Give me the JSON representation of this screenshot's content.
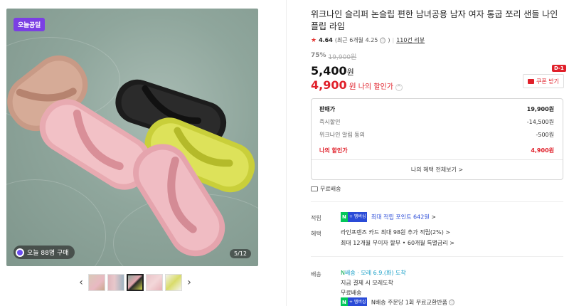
{
  "gallery": {
    "badge": "오늘공딜",
    "buy_count": "오늘 88명 구매",
    "counter": "5/12",
    "prev": "‹",
    "next": "›",
    "thumb_count": 5,
    "active_thumb": 3
  },
  "product": {
    "title": "위크나인 슬리퍼 논슬립 편한 남녀공용 남자 여자 통굽 쪼리 샌들 나인플립 라임",
    "rating_score": "4.64",
    "rating_note": "(최근 6개월 4.25",
    "rating_icon": "ⓘ",
    "rating_close": ")",
    "review_count": "110건 리뷰",
    "discount_pct": "75%",
    "original_price": "19,900원",
    "price": "5,400",
    "price_unit": "원",
    "my_price": "4,900",
    "my_price_unit": "원",
    "my_price_label": "나의 할인가",
    "my_price_chevron": "^"
  },
  "coupon": {
    "label": "쿠폰 받기",
    "dday": "D-1"
  },
  "discount_box": {
    "rows": [
      {
        "label": "판매가",
        "value": "19,900원"
      },
      {
        "label": "즉시할인",
        "value": "-14,500원"
      },
      {
        "label": "위크나인 알림 동의",
        "value": "-500원"
      }
    ],
    "mine": {
      "label": "나의 할인가",
      "value": "4,900원"
    },
    "more": "나의 혜택 전체보기 >"
  },
  "shipping": {
    "label": "무료배송"
  },
  "benefits": {
    "points_label": "적립",
    "points_npay": "N",
    "points_plus": "+ 멤버십",
    "points_text": "최대 적립 포인트 642원",
    "points_chev": ">",
    "card_label": "혜택",
    "card_line1": "라인프렌즈 카드 최대 98원 추가 적립(2%)",
    "card_line1_chev": ">",
    "card_line2": "최대 12개월 무이자 할부 • 60개월 특별금리",
    "card_line2_chev": ">"
  },
  "delivery": {
    "label": "배송",
    "brand": "배송",
    "arrival": "· 모레 6.9.(화) 도착",
    "line2": "지금 결제 시 모레도착",
    "line3": "무료배송",
    "npay_text": "N배송 주문당 1회 무료교환반품"
  },
  "colors": {
    "red": "#e0202a",
    "purple": "#7b3fe4",
    "naver_green": "#03c75a",
    "link_blue": "#2a4bd7"
  }
}
